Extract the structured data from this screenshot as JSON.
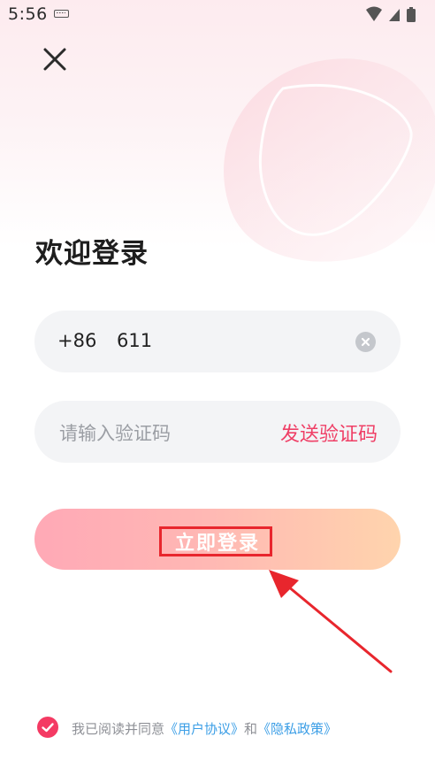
{
  "status_bar": {
    "time": "5:56",
    "icons": [
      "keyboard-icon",
      "wifi-icon",
      "signal-icon",
      "battery-icon"
    ]
  },
  "header": {
    "close_icon": "close-icon"
  },
  "title": "欢迎登录",
  "phone_field": {
    "country_code": "+86",
    "value": "611",
    "clear_icon": "clear-icon"
  },
  "code_field": {
    "placeholder": "请输入验证码",
    "send_label": "发送验证码"
  },
  "login_button": {
    "label": "立即登录"
  },
  "agreement": {
    "checked": true,
    "prefix": "我已阅读并同意",
    "user_agreement": "《用户协议》",
    "conjunction": "和",
    "privacy_policy": "《隐私政策》"
  },
  "colors": {
    "accent": "#ef3f66",
    "link": "#3b9ee6",
    "annotation": "#e8262d",
    "button_gradient_start": "#ffa9b6",
    "button_gradient_end": "#ffd4ad"
  }
}
